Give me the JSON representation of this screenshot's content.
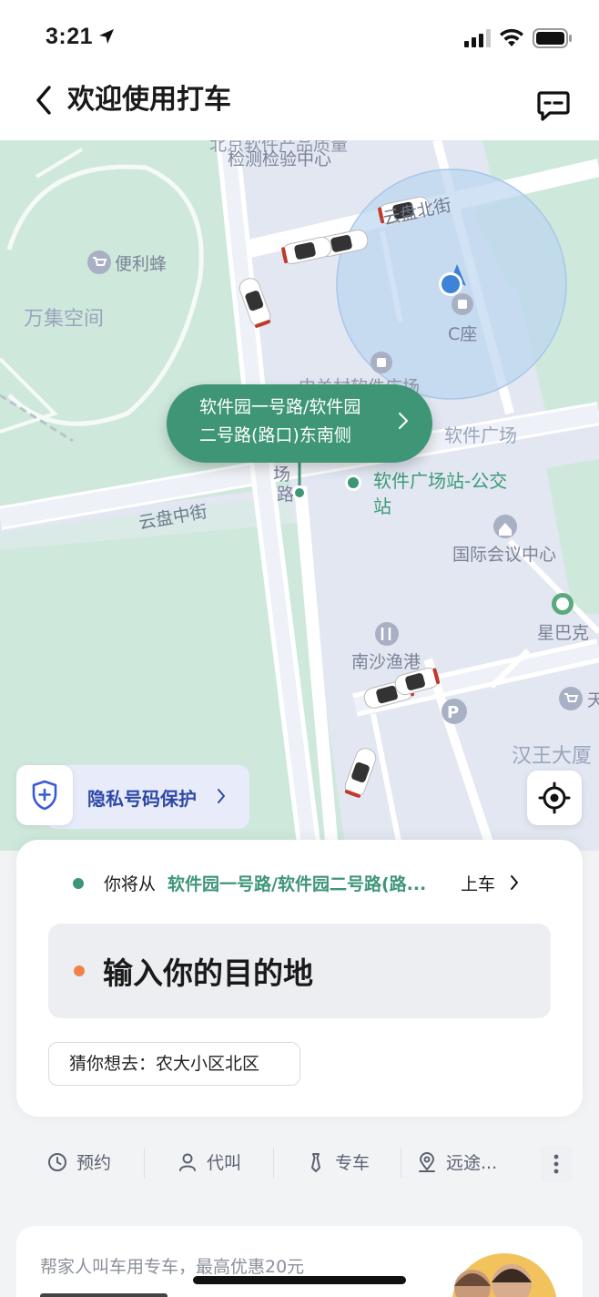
{
  "status_bar": {
    "time": "3:21"
  },
  "nav": {
    "title": "欢迎使用打车"
  },
  "map": {
    "labels": {
      "top_road": "北京软件产品质量",
      "top_poi": "检测检验中心",
      "bianlifeng": "便利蜂",
      "wanji": "万集空间",
      "yunpan_north": "云盘北街",
      "c_seat": "C座",
      "zgc": "中关村软件广场",
      "software_square": "软件广场",
      "square_side": "场",
      "road_side": "路",
      "bus_stop": "软件广场站-公交站",
      "yunpan_middle": "云盘中街",
      "conference": "国际会议中心",
      "starbucks": "星巴克",
      "nanshayugang": "南沙渔港",
      "hanwang": "汉王大厦",
      "tian": "天"
    },
    "pickup_bubble": {
      "line1": "软件园一号路/软件园",
      "line2": "二号路(路口)东南侧"
    },
    "privacy": {
      "label": "隐私号码保护"
    },
    "colors": {
      "map_bg": "#e2e7f2",
      "green": "#cfe8dc",
      "accent": "#3e9677",
      "radius": "#bcd5f0"
    }
  },
  "card": {
    "pickup_prefix": "你将从",
    "pickup_address": "软件园一号路/软件园二号路(路...",
    "pickup_suffix": "上车",
    "destination_placeholder": "输入你的目的地",
    "guess": "猜你想去：农大小区北区"
  },
  "tabs": [
    {
      "label": "预约",
      "icon": "clock-icon"
    },
    {
      "label": "代叫",
      "icon": "person-icon"
    },
    {
      "label": "专车",
      "icon": "tie-icon"
    },
    {
      "label": "远途...",
      "icon": "route-pin-icon"
    }
  ],
  "promo": {
    "text": "帮家人叫车用专车，最高优惠20元"
  }
}
